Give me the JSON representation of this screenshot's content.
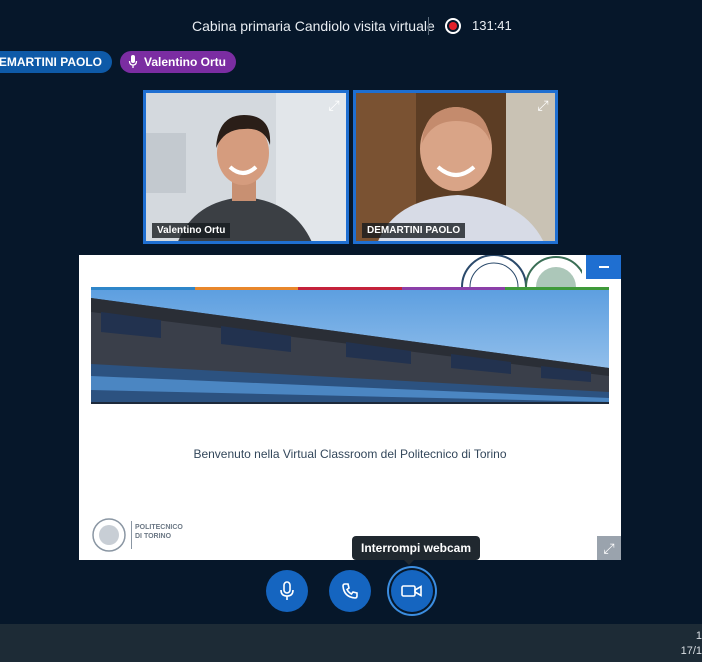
{
  "header": {
    "session_title": "Cabina primaria Candiolo visita virtuale",
    "recording_icon": "record-icon",
    "timer": "131:41"
  },
  "participants_bar": [
    {
      "label": "DEMARTINI PAOLO",
      "color": "#0e5aa8"
    },
    {
      "label": "Valentino Ortu",
      "color": "#7b2da2",
      "speaking": true,
      "icon": "microphone-icon"
    }
  ],
  "video_tiles": [
    {
      "name": "Valentino Ortu",
      "icon": "expand-icon"
    },
    {
      "name": "DEMARTINI PAOLO",
      "icon": "expand-icon"
    }
  ],
  "presentation": {
    "welcome_text": "Benvenuto nella Virtual Classroom del Politecnico di Torino",
    "logo_text_line1": "POLITECNICO",
    "logo_text_line2": "DI TORINO",
    "colorbar": [
      "#2f86c9",
      "#e8872b",
      "#c4223b",
      "#8b3fa8",
      "#3f9a3a"
    ]
  },
  "tooltip": {
    "text": "Interrompi webcam"
  },
  "controls": [
    {
      "name": "microphone-button",
      "icon": "microphone-icon"
    },
    {
      "name": "hangup-button",
      "icon": "phone-icon"
    },
    {
      "name": "webcam-button",
      "icon": "webcam-icon"
    }
  ],
  "taskbar": {
    "time_partial": "1",
    "date_partial": "17/1"
  },
  "colors": {
    "background": "#06172a",
    "accent": "#1565c0",
    "tile_border": "#1f6fd1"
  }
}
